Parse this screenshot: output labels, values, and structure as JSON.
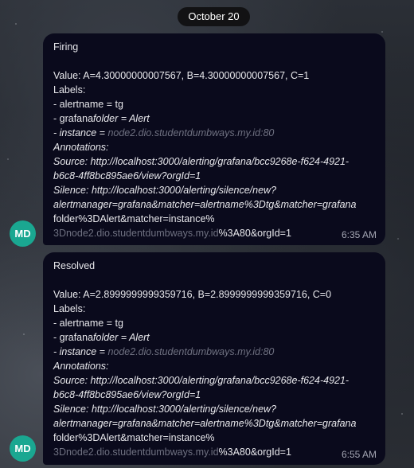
{
  "date_separator": "October 20",
  "messages": [
    {
      "status": "Firing",
      "value_line": "Value: A=4.30000000007567, B=4.30000000007567, C=1",
      "labels_heading": "Labels:",
      "label_alertname_prefix": " - alertname = tg",
      "label_folder_prefix": " - grafana",
      "label_folder_rest": "folder = Alert",
      "label_instance_prefix": " - instance = ",
      "label_instance_value": "node2.dio.studentdumbways.my.id:80",
      "annotations_heading": "Annotations:",
      "source_line1": "Source: http://localhost:3000/alerting/grafana/bcc9268e-f624-4921-",
      "source_line2": "b6c8-4ff8bc895ae6/view?orgId=1",
      "silence_line1": "Silence: http://localhost:3000/alerting/silence/new?",
      "silence_line2": "alertmanager=grafana&matcher=alertname%3Dtg&matcher=grafana",
      "silence_line3": "folder%3DAlert&matcher=instance%",
      "silence_line4_muted": "3Dnode2.dio.studentdumbways.my.id",
      "silence_line4_rest": "%3A80&orgId=1",
      "time": "6:35 AM",
      "avatar": "MD"
    },
    {
      "status": "Resolved",
      "value_line": "Value: A=2.8999999999359716, B=2.8999999999359716, C=0",
      "labels_heading": "Labels:",
      "label_alertname_prefix": " - alertname = tg",
      "label_folder_prefix": " - grafana",
      "label_folder_rest": "folder = Alert",
      "label_instance_prefix": " - instance = ",
      "label_instance_value": "node2.dio.studentdumbways.my.id:80",
      "annotations_heading": "Annotations:",
      "source_line1": "Source: http://localhost:3000/alerting/grafana/bcc9268e-f624-4921-",
      "source_line2": "b6c8-4ff8bc895ae6/view?orgId=1",
      "silence_line1": "Silence: http://localhost:3000/alerting/silence/new?",
      "silence_line2": "alertmanager=grafana&matcher=alertname%3Dtg&matcher=grafana",
      "silence_line3": "folder%3DAlert&matcher=instance%",
      "silence_line4_muted": "3Dnode2.dio.studentdumbways.my.id",
      "silence_line4_rest": "%3A80&orgId=1",
      "time": "6:55 AM",
      "avatar": "MD"
    }
  ]
}
